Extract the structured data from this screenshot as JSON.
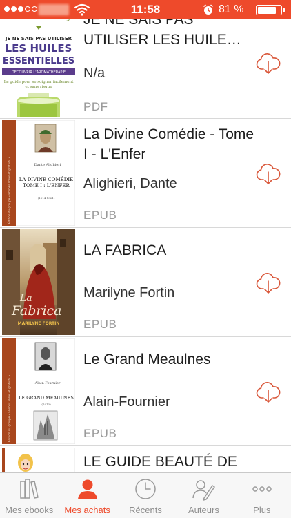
{
  "status_bar": {
    "time": "11:58",
    "battery_percent": "81 %",
    "battery_level": 0.81,
    "signal_bars_filled": 3,
    "signal_bars_total": 5,
    "icons": [
      "signal-dots-icon",
      "wifi-icon",
      "alarm-icon",
      "battery-icon"
    ],
    "background": "#ee4a2b"
  },
  "books": [
    {
      "title": "JE NE SAIS PAS UTILISER LES HUILE…",
      "author": "N/a",
      "format": "PDF",
      "cover": {
        "author": "Danièle Festy",
        "line1": "JE NE SAIS PAS UTILISER",
        "line2": "LES HUILES",
        "line3": "ESSENTIELLES",
        "band": "DÉCOUVRIR L'AROMATHÉRAPIE",
        "tagline1": "Le guide pour se soigner facilement",
        "tagline2": "et sans risque"
      }
    },
    {
      "title": "La Divine Comédie - Tome I - L'Enfer",
      "author": "Alighieri, Dante",
      "format": "EPUB",
      "cover": {
        "author": "Dante Alighieri",
        "title1": "LA DIVINE COMÉDIE",
        "title2": "TOME I : L'ENFER",
        "sub": "(1314-1321)",
        "spine": "Édition du groupe « Ebooks libres et gratuits »"
      }
    },
    {
      "title": "LA FABRICA",
      "author": "Marilyne Fortin",
      "format": "EPUB",
      "cover": {
        "word1": "La",
        "word2": "Fabrica",
        "author": "MARILYNE FORTIN"
      }
    },
    {
      "title": "Le Grand Meaulnes",
      "author": "Alain-Fournier",
      "format": "EPUB",
      "cover": {
        "author": "Alain-Fournier",
        "title": "LE GRAND MEAULNES",
        "sub": "(1913)",
        "spine": "Édition du groupe « Ebooks libres et gratuits »"
      }
    },
    {
      "title": "LE GUIDE BEAUTÉ DE",
      "author": "",
      "format": "",
      "cover": {}
    }
  ],
  "tabbar": {
    "active_tab": "Mes achats",
    "accent": "#ee4a2b",
    "tabs": [
      {
        "label": "Mes ebooks",
        "icon": "books-shelf-icon"
      },
      {
        "label": "Mes achats",
        "icon": "user-icon"
      },
      {
        "label": "Récents",
        "icon": "clock-icon"
      },
      {
        "label": "Auteurs",
        "icon": "author-icon"
      },
      {
        "label": "Plus",
        "icon": "more-icon"
      }
    ]
  }
}
